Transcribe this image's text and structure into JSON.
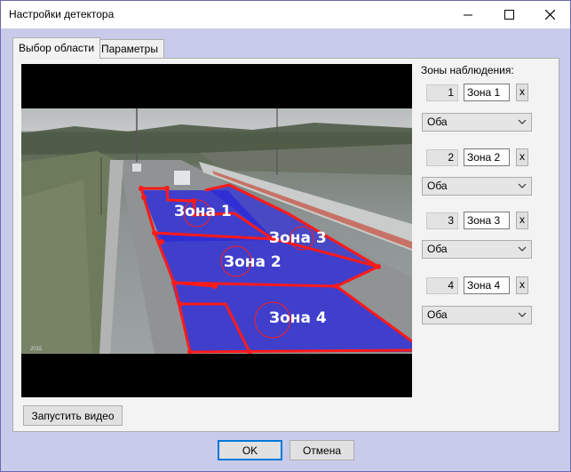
{
  "window": {
    "title": "Настройки детектора",
    "controls": {
      "minimize": "minimize-icon",
      "maximize": "maximize-icon",
      "close": "close-icon"
    }
  },
  "tabs": [
    {
      "label": "Выбор области",
      "active": true
    },
    {
      "label": "Параметры",
      "active": false
    }
  ],
  "video": {
    "timestamp": "2015",
    "zone_labels": [
      "Зона 1",
      "Зона 2",
      "Зона 3",
      "Зона 4"
    ],
    "overlay_color": "#ff1a1a",
    "zone_fill_color": "#2a2ad8"
  },
  "zones_panel": {
    "title": "Зоны наблюдения:",
    "zones": [
      {
        "number": "1",
        "name": "Зона 1",
        "remove": "x",
        "direction": "Оба"
      },
      {
        "number": "2",
        "name": "Зона 2",
        "remove": "x",
        "direction": "Оба"
      },
      {
        "number": "3",
        "name": "Зона 3",
        "remove": "x",
        "direction": "Оба"
      },
      {
        "number": "4",
        "name": "Зона 4",
        "remove": "x",
        "direction": "Оба"
      }
    ]
  },
  "buttons": {
    "start_video": "Запустить видео",
    "ok": "OK",
    "cancel": "Отмена"
  }
}
